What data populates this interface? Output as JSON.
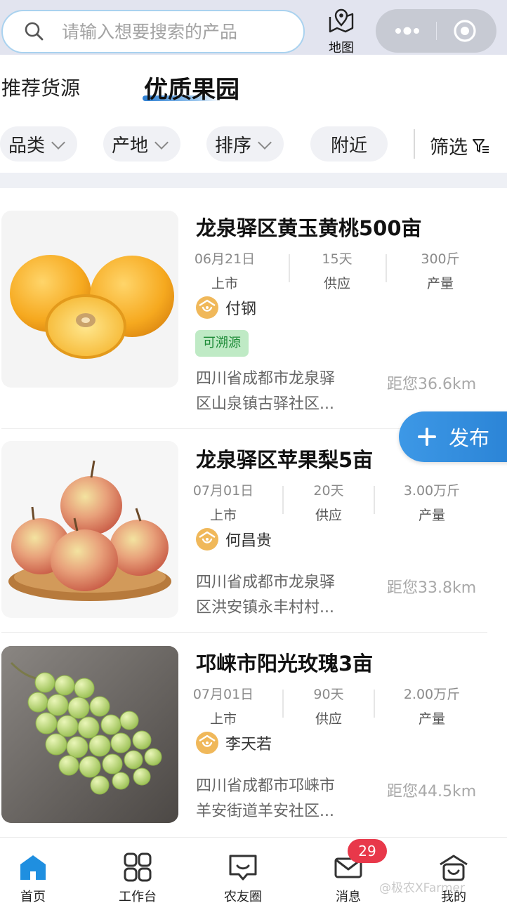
{
  "search": {
    "placeholder": "请输入想要搜索的产品"
  },
  "header": {
    "map_label": "地图"
  },
  "tabs": [
    {
      "label": "推荐货源",
      "active": false
    },
    {
      "label": "优质果园",
      "active": true
    }
  ],
  "filters": {
    "chips": [
      {
        "label": "品类",
        "has_dropdown": true
      },
      {
        "label": "产地",
        "has_dropdown": true
      },
      {
        "label": "排序",
        "has_dropdown": true
      },
      {
        "label": "附近",
        "has_dropdown": false
      }
    ],
    "screen_label": "筛选"
  },
  "listings": [
    {
      "title": "龙泉驿区黄玉黄桃500亩",
      "date": "06月21日",
      "date_label": "上市",
      "supply": "15天",
      "supply_label": "供应",
      "yield": "300斤",
      "yield_label": "产量",
      "owner": "付钢",
      "trace_badge": "可溯源",
      "address_line1": "四川省成都市龙泉驿",
      "address_line2": "区山泉镇古驿社区...",
      "distance": "距您36.6km",
      "image": "yellow-peach"
    },
    {
      "title": "龙泉驿区苹果梨5亩",
      "date": "07月01日",
      "date_label": "上市",
      "supply": "20天",
      "supply_label": "供应",
      "yield": "3.00万斤",
      "yield_label": "产量",
      "owner": "何昌贵",
      "address_line1": "四川省成都市龙泉驿",
      "address_line2": "区洪安镇永丰村村...",
      "distance": "距您33.8km",
      "image": "apple-pear"
    },
    {
      "title": "邛崃市阳光玫瑰3亩",
      "date": "07月01日",
      "date_label": "上市",
      "supply": "90天",
      "supply_label": "供应",
      "yield": "2.00万斤",
      "yield_label": "产量",
      "owner": "李天若",
      "address_line1": "四川省成都市邛崃市",
      "address_line2": "羊安街道羊安社区...",
      "distance": "距您44.5km",
      "image": "green-grapes"
    }
  ],
  "fab": {
    "label": "发布"
  },
  "bottom_nav": [
    {
      "label": "首页",
      "icon": "home-icon",
      "active": true
    },
    {
      "label": "工作台",
      "icon": "grid-icon",
      "active": false
    },
    {
      "label": "农友圈",
      "icon": "chat-icon",
      "active": false
    },
    {
      "label": "消息",
      "icon": "mail-icon",
      "active": false,
      "badge": "29"
    },
    {
      "label": "我的",
      "icon": "farmer-icon",
      "active": false
    }
  ],
  "watermark": "@极农XFarmer",
  "colors": {
    "accent": "#2b84d6",
    "badge": "#e8384a",
    "trace_bg": "#bfeac5",
    "trace_text": "#1c8a36"
  }
}
